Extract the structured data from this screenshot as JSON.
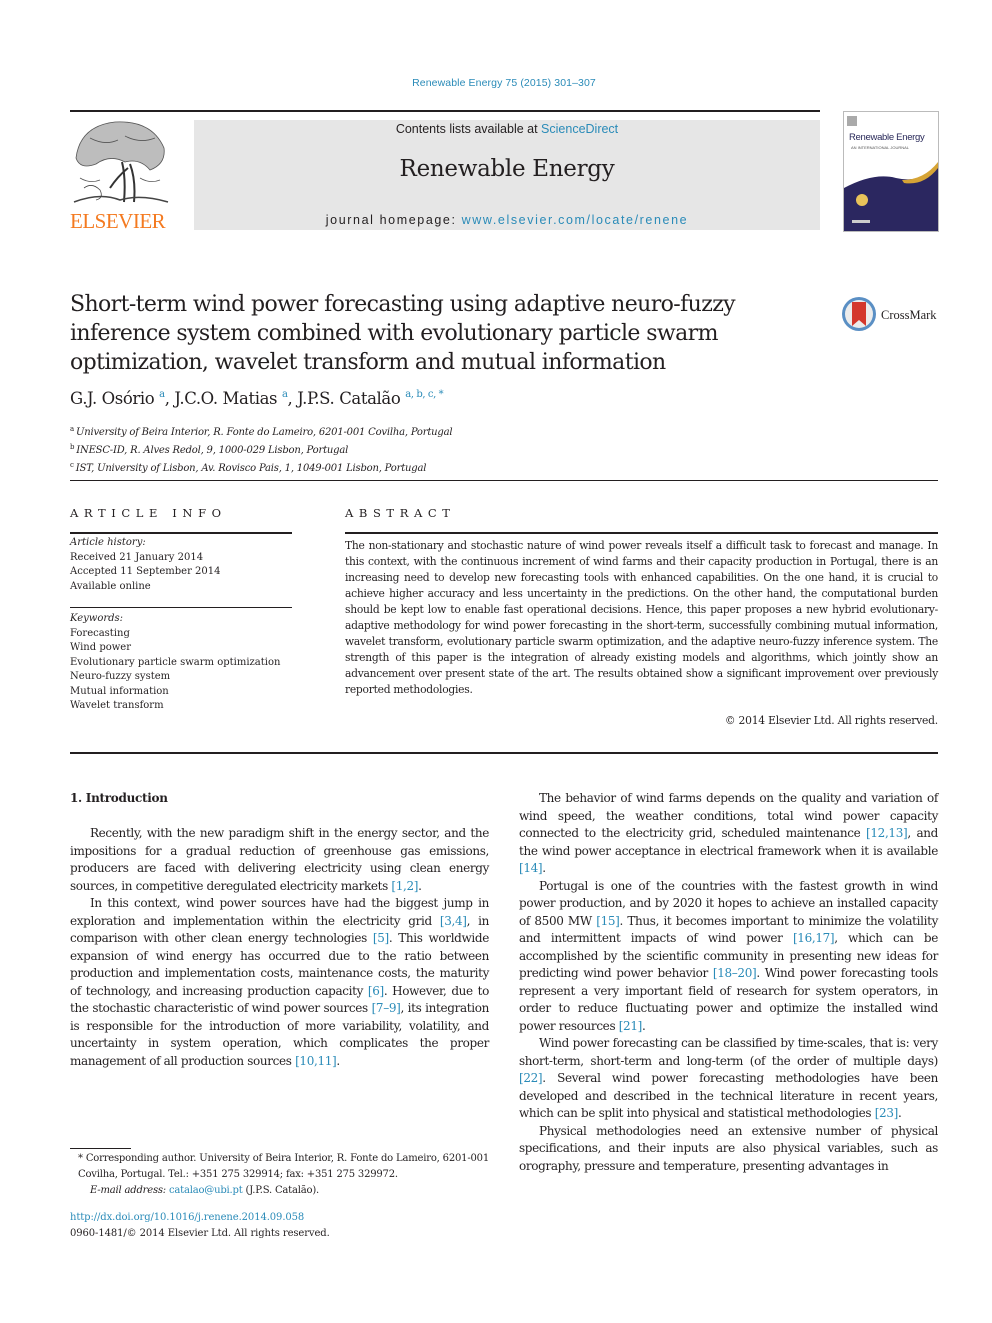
{
  "header": {
    "journal_citation": "Renewable Energy 75 (2015) 301–307",
    "contents_prefix": "Contents lists available at ",
    "contents_link": "ScienceDirect",
    "journal_name": "Renewable Energy",
    "homepage_prefix": "journal homepage: ",
    "homepage_link": "www.elsevier.com/locate/renene",
    "publisher_logo_text": "ELSEVIER",
    "cover_title": "Renewable Energy",
    "cover_subtitle": "AN INTERNATIONAL JOURNAL",
    "crossmark_label": "CrossMark"
  },
  "article": {
    "title": "Short-term wind power forecasting using adaptive neuro-fuzzy inference system combined with evolutionary particle swarm optimization, wavelet transform and mutual information",
    "authors": [
      {
        "name": "G.J. Osório",
        "sup": "a",
        "sep": ", "
      },
      {
        "name": "J.C.O. Matias",
        "sup": "a",
        "sep": ", "
      },
      {
        "name": "J.P.S. Catalão",
        "sup": "a, b, c, *",
        "sep": ""
      }
    ],
    "affiliations": [
      {
        "key": "a",
        "text": "University of Beira Interior, R. Fonte do Lameiro, 6201-001 Covilha, Portugal"
      },
      {
        "key": "b",
        "text": "INESC-ID, R. Alves Redol, 9, 1000-029 Lisbon, Portugal"
      },
      {
        "key": "c",
        "text": "IST, University of Lisbon, Av. Rovisco Pais, 1, 1049-001 Lisbon, Portugal"
      }
    ]
  },
  "article_info": {
    "heading": "ARTICLE INFO",
    "history_label": "Article history:",
    "history": [
      "Received 21 January 2014",
      "Accepted 11 September 2014",
      "Available online"
    ],
    "keywords_label": "Keywords:",
    "keywords": [
      "Forecasting",
      "Wind power",
      "Evolutionary particle swarm optimization",
      "Neuro-fuzzy system",
      "Mutual information",
      "Wavelet transform"
    ]
  },
  "abstract": {
    "heading": "ABSTRACT",
    "text": "The non-stationary and stochastic nature of wind power reveals itself a difficult task to forecast and manage. In this context, with the continuous increment of wind farms and their capacity production in Portugal, there is an increasing need to develop new forecasting tools with enhanced capabilities. On the one hand, it is crucial to achieve higher accuracy and less uncertainty in the predictions. On the other hand, the computational burden should be kept low to enable fast operational decisions. Hence, this paper proposes a new hybrid evolutionary-adaptive methodology for wind power forecasting in the short-term, successfully combining mutual information, wavelet transform, evolutionary particle swarm optimization, and the adaptive neuro-fuzzy inference system. The strength of this paper is the integration of already existing models and algorithms, which jointly show an advancement over present state of the art. The results obtained show a significant improvement over previously reported methodologies.",
    "copyright": "© 2014 Elsevier Ltd. All rights reserved."
  },
  "body": {
    "section_heading": "1.  Introduction",
    "left_paragraphs": [
      [
        {
          "t": "Recently, with the new paradigm shift in the energy sector, and the impositions for a gradual reduction of greenhouse gas emissions, producers are faced with delivering electricity using clean energy sources, in competitive deregulated electricity markets "
        },
        {
          "ref": "[1,2]"
        },
        {
          "t": "."
        }
      ],
      [
        {
          "t": "In this context, wind power sources have had the biggest jump in exploration and implementation within the electricity grid "
        },
        {
          "ref": "[3,4]"
        },
        {
          "t": ", in comparison with other clean energy technologies "
        },
        {
          "ref": "[5]"
        },
        {
          "t": ". This worldwide expansion of wind energy has occurred due to the ratio between production and implementation costs, maintenance costs, the maturity of technology, and increasing production capacity "
        },
        {
          "ref": "[6]"
        },
        {
          "t": ". However, due to the stochastic characteristic of wind power sources "
        },
        {
          "ref": "[7–9]"
        },
        {
          "t": ", its integration is responsible for the introduction of more variability, volatility, and uncertainty in system operation, which complicates the proper management of all production sources "
        },
        {
          "ref": "[10,11]"
        },
        {
          "t": "."
        }
      ]
    ],
    "right_paragraphs": [
      [
        {
          "t": "The behavior of wind farms depends on the quality and variation of wind speed, the weather conditions, total wind power capacity connected to the electricity grid, scheduled maintenance "
        },
        {
          "ref": "[12,13]"
        },
        {
          "t": ", and the wind power acceptance in electrical framework when it is available "
        },
        {
          "ref": "[14]"
        },
        {
          "t": "."
        }
      ],
      [
        {
          "t": "Portugal is one of the countries with the fastest growth in wind power production, and by 2020 it hopes to achieve an installed capacity of 8500 MW "
        },
        {
          "ref": "[15]"
        },
        {
          "t": ". Thus, it becomes important to minimize the volatility and intermittent impacts of wind power "
        },
        {
          "ref": "[16,17]"
        },
        {
          "t": ", which can be accomplished by the scientific community in presenting new ideas for predicting wind power behavior "
        },
        {
          "ref": "[18–20]"
        },
        {
          "t": ". Wind power forecasting tools represent a very important field of research for system operators, in order to reduce fluctuating power and optimize the installed wind power resources "
        },
        {
          "ref": "[21]"
        },
        {
          "t": "."
        }
      ],
      [
        {
          "t": "Wind power forecasting can be classified by time-scales, that is: very short-term, short-term and long-term (of the order of multiple days) "
        },
        {
          "ref": "[22]"
        },
        {
          "t": ". Several wind power forecasting methodologies have been developed and described in the technical literature in recent years, which can be split into physical and statistical methodologies "
        },
        {
          "ref": "[23]"
        },
        {
          "t": "."
        }
      ],
      [
        {
          "t": "Physical methodologies need an extensive number of physical specifications, and their inputs are also physical variables, such as orography, pressure and temperature, presenting advantages in"
        }
      ]
    ]
  },
  "footnote": {
    "corresponding": "* Corresponding author. University of Beira Interior, R. Fonte do Lameiro, 6201-001 Covilha, Portugal. Tel.: +351 275 329914; fax: +351 275 329972.",
    "email_label": "E-mail address:",
    "email": "catalao@ubi.pt",
    "email_suffix": " (J.P.S. Catalão).",
    "doi": "http://dx.doi.org/10.1016/j.renene.2014.09.058",
    "issn_copyright": "0960-1481/© 2014 Elsevier Ltd. All rights reserved."
  },
  "colors": {
    "link": "#2a8bb8",
    "elsevier_orange": "#f47a20",
    "banner_bg": "#e6e6e6",
    "cover_navy": "#2b2760",
    "cover_gold": "#d6a436",
    "crossmark_red": "#d4372c"
  }
}
